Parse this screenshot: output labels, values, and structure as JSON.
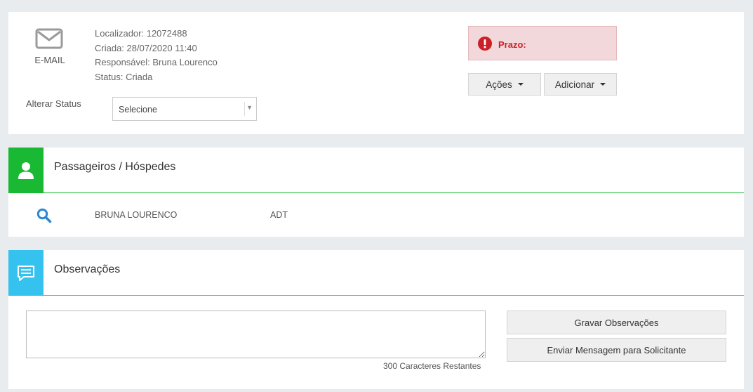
{
  "header": {
    "channel_label": "E-MAIL",
    "localizador": "Localizador: 12072488",
    "criada": "Criada: 28/07/2020 11:40",
    "responsavel": "Responsável: Bruna Lourenco",
    "status": "Status: Criada",
    "alterar_status_label": "Alterar Status",
    "status_select_value": "Selecione",
    "prazo_label": "Prazo:",
    "acoes_label": "Ações",
    "adicionar_label": "Adicionar"
  },
  "passengers": {
    "title": "Passageiros / Hóspedes",
    "accent": "#1ab934",
    "rows": [
      {
        "name": "BRUNA LOURENCO",
        "type": "ADT"
      }
    ]
  },
  "observations": {
    "title": "Observações",
    "accent": "#35c2ef",
    "textarea_value": "",
    "remaining_label": "300 Caracteres Restantes",
    "save_label": "Gravar Observações",
    "send_label": "Enviar Mensagem para Solicitante"
  },
  "colors": {
    "prazo_bg": "#f2d8da",
    "prazo_text": "#cc1f26",
    "search_icon": "#2a86d6"
  }
}
